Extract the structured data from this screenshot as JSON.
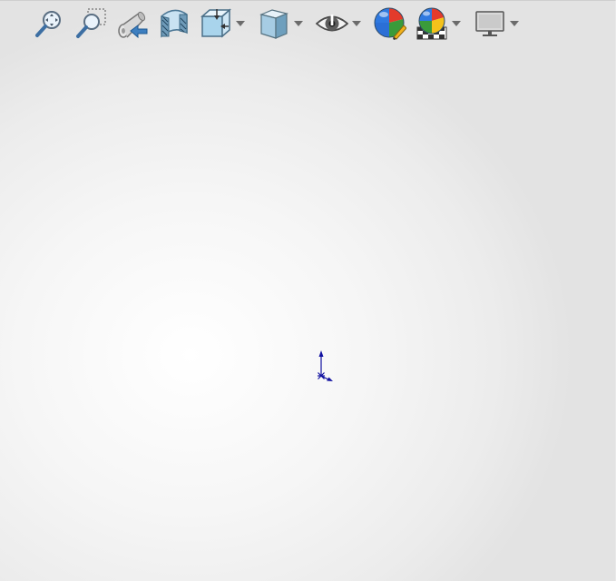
{
  "toolbar": {
    "name": "heads-up-view-toolbar",
    "tools": [
      {
        "id": "zoom-to-fit",
        "icon": "zoom-to-fit-icon",
        "has_dropdown": false
      },
      {
        "id": "zoom-to-area",
        "icon": "zoom-to-area-icon",
        "has_dropdown": false
      },
      {
        "id": "previous-view",
        "icon": "previous-view-icon",
        "has_dropdown": false
      },
      {
        "id": "section-view",
        "icon": "section-view-icon",
        "has_dropdown": false
      },
      {
        "id": "view-orientation",
        "icon": "view-orientation-icon",
        "has_dropdown": true
      },
      {
        "id": "display-style",
        "icon": "display-style-icon",
        "has_dropdown": true
      },
      {
        "id": "hide-show-items",
        "icon": "hide-show-eye-icon",
        "has_dropdown": true
      },
      {
        "id": "edit-appearance",
        "icon": "edit-appearance-icon",
        "has_dropdown": false
      },
      {
        "id": "apply-scene",
        "icon": "apply-scene-icon",
        "has_dropdown": true
      },
      {
        "id": "view-settings",
        "icon": "view-settings-monitor-icon",
        "has_dropdown": true
      }
    ]
  },
  "graphics_area": {
    "background_colors": [
      "#ffffff",
      "#e3e3e3"
    ],
    "triad_color": "#1010a0"
  }
}
